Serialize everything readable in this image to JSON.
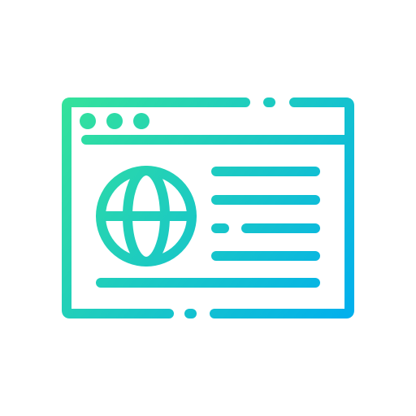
{
  "icon": {
    "name": "web-browser-globe-icon",
    "gradient_start": "#34E29B",
    "gradient_end": "#00AEEF"
  }
}
